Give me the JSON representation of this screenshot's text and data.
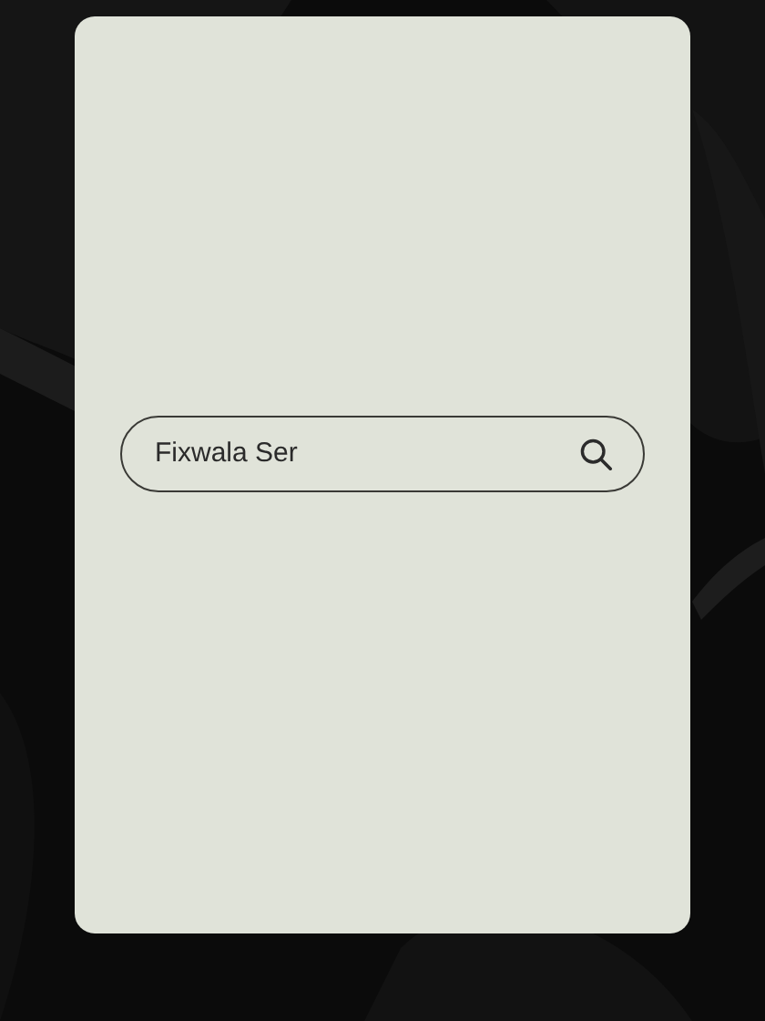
{
  "search": {
    "value": "Fixwala Ser"
  }
}
